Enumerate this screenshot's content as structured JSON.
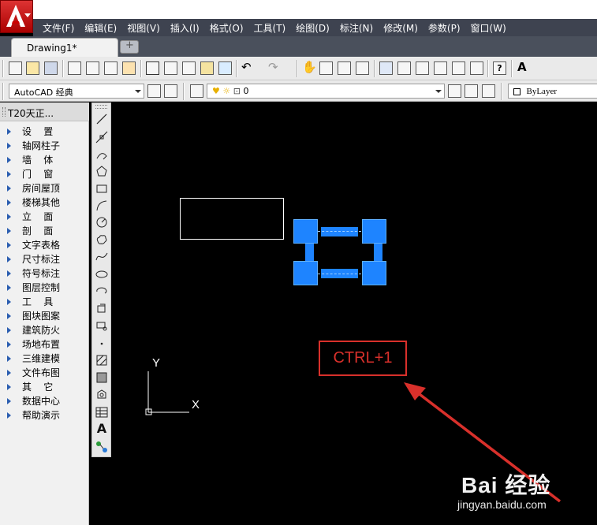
{
  "app": {
    "logo_letter": "A"
  },
  "menubar": {
    "items": [
      "文件(F)",
      "编辑(E)",
      "视图(V)",
      "插入(I)",
      "格式(O)",
      "工具(T)",
      "绘图(D)",
      "标注(N)",
      "修改(M)",
      "参数(P)",
      "窗口(W)"
    ]
  },
  "tabs": {
    "active_label": "Drawing1*"
  },
  "toolbar2": {
    "workspace": "AutoCAD 经典",
    "layer_value": "0",
    "linetype_value": "ByLayer"
  },
  "t20_panel": {
    "title": "T20天正...",
    "items": [
      "设    置",
      "轴网柱子",
      "墙    体",
      "门    窗",
      "房间屋顶",
      "楼梯其他",
      "立    面",
      "剖    面",
      "文字表格",
      "尺寸标注",
      "符号标注",
      "图层控制",
      "工    具",
      "图块图案",
      "建筑防火",
      "场地布置",
      "三维建模",
      "文件布图",
      "其    它",
      "数据中心",
      "帮助演示"
    ]
  },
  "canvas": {
    "ucs_x": "X",
    "ucs_y": "Y",
    "annotation": "CTRL+1",
    "annotation_color": "#d8302b",
    "grip_color": "#1e84ff"
  },
  "watermark": {
    "brand": "Bai 经验",
    "url": "jingyan.baidu.com"
  }
}
